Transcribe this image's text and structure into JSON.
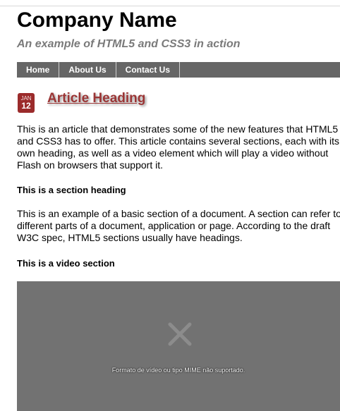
{
  "header": {
    "company_name": "Company Name",
    "tagline": "An example of HTML5 and CSS3 in action"
  },
  "nav": {
    "items": [
      {
        "label": "Home"
      },
      {
        "label": "About Us"
      },
      {
        "label": "Contact Us"
      }
    ]
  },
  "article": {
    "date_month": "JAN",
    "date_day": "12",
    "heading": "Article Heading",
    "intro": "This is an article that demonstrates some of the new features that HTML5 and CSS3 has to offer. This article contains several sections, each with its own heading, as well as a video element which will play a video without Flash on browsers that support it.",
    "section1_heading": "This is a section heading",
    "section1_text": "This is an example of a basic section of a document. A section can refer to different parts of a document, application or page. According to the draft W3C spec, HTML5 sections usually have headings.",
    "video_heading": "This is a video section",
    "video_error": "Formato de vídeo ou tipo MIME não suportado."
  },
  "colors": {
    "nav_bg": "#666666",
    "accent": "#9b2b2b",
    "heading_link": "#9b3535",
    "video_bg": "#727272"
  },
  "icons": {
    "video_error_icon": "close-icon"
  }
}
